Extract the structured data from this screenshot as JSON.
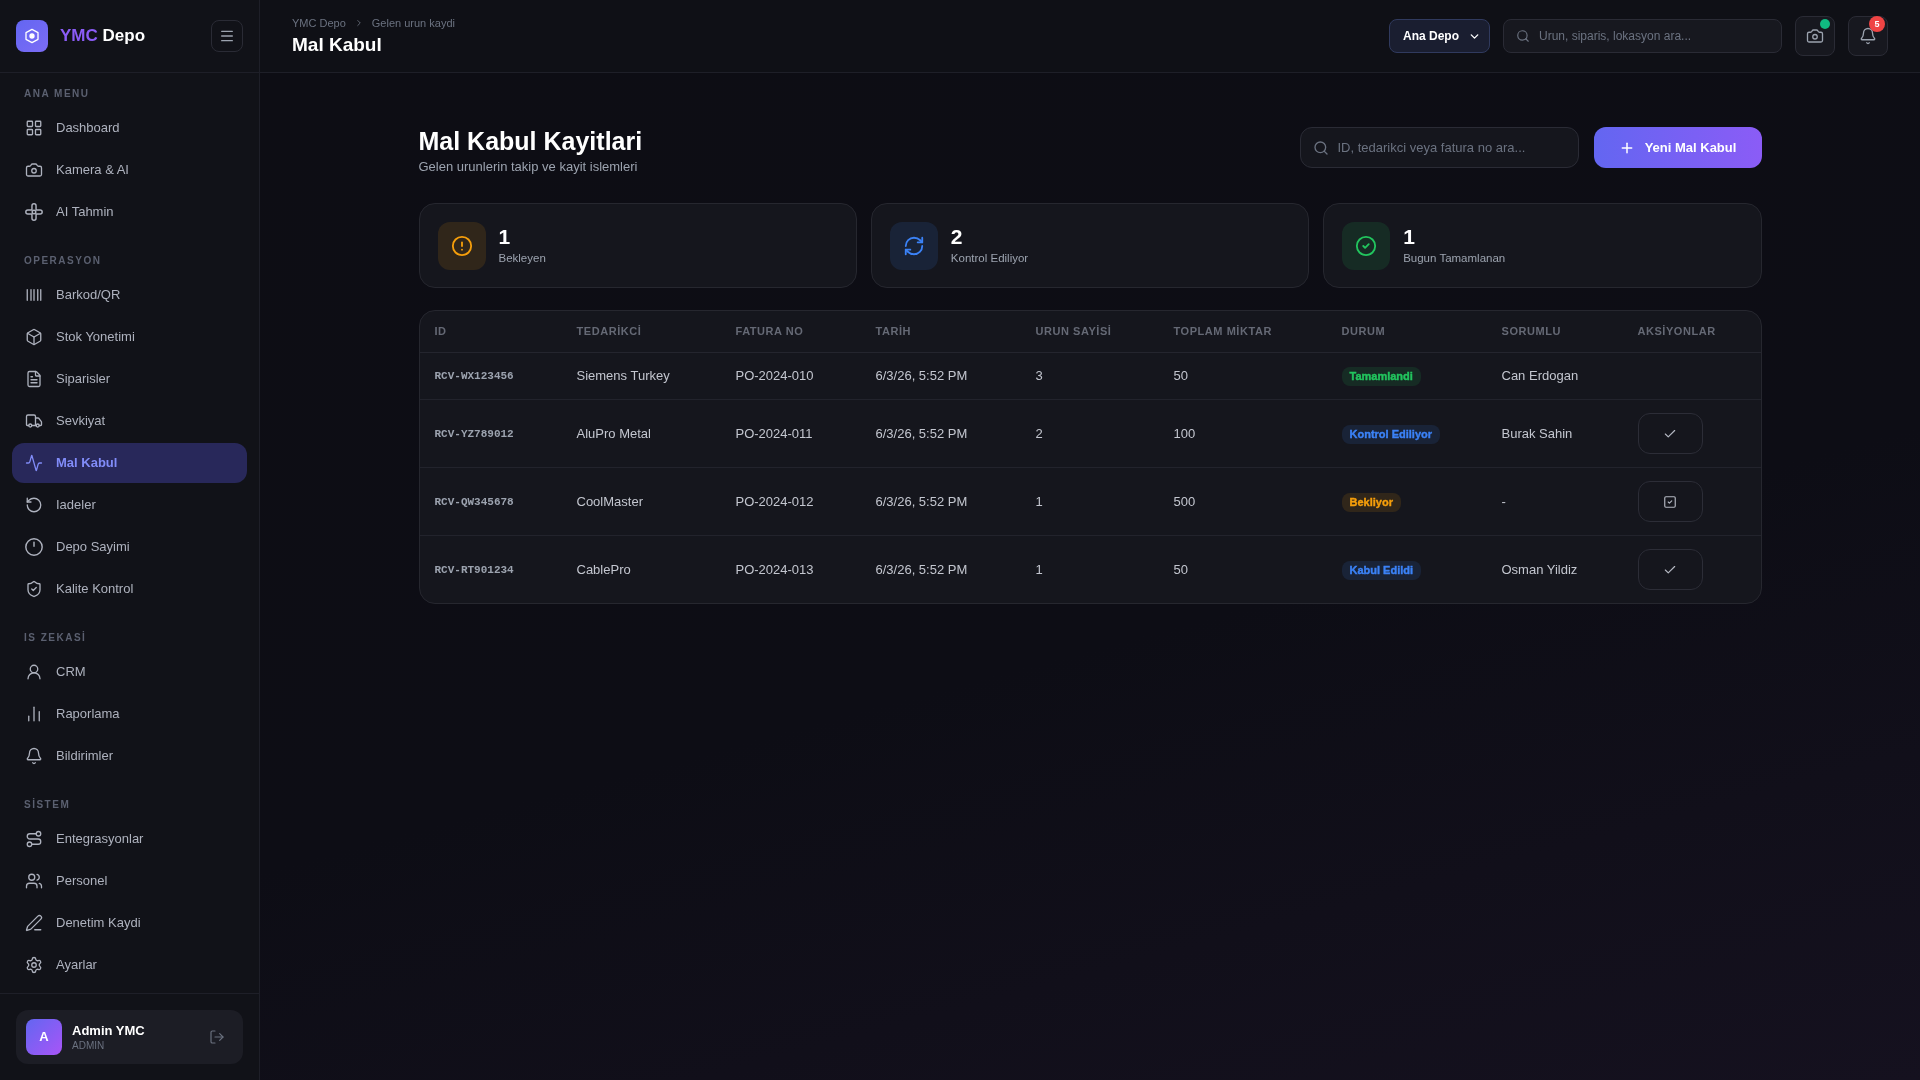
{
  "sidebar": {
    "brand": {
      "accent": "YMC",
      "name": "Depo"
    },
    "sections": [
      {
        "label": "ANA MENU",
        "items": [
          {
            "label": "Dashboard",
            "selected": false
          },
          {
            "label": "Kamera & AI",
            "selected": false
          },
          {
            "label": "AI Tahmin",
            "selected": false
          }
        ]
      },
      {
        "label": "OPERASYON",
        "items": [
          {
            "label": "Barkod/QR",
            "selected": false
          },
          {
            "label": "Stok Yonetimi",
            "selected": false
          },
          {
            "label": "Siparisler",
            "selected": false
          },
          {
            "label": "Sevkiyat",
            "selected": false
          },
          {
            "label": "Mal Kabul",
            "selected": true
          },
          {
            "label": "Iadeler",
            "selected": false
          },
          {
            "label": "Depo Sayimi",
            "selected": false
          },
          {
            "label": "Kalite Kontrol",
            "selected": false
          }
        ]
      },
      {
        "label": "IS ZEKASİ",
        "items": [
          {
            "label": "CRM",
            "selected": false
          },
          {
            "label": "Raporlama",
            "selected": false
          },
          {
            "label": "Bildirimler",
            "selected": false
          }
        ]
      },
      {
        "label": "SİSTEM",
        "items": [
          {
            "label": "Entegrasyonlar",
            "selected": false
          },
          {
            "label": "Personel",
            "selected": false
          },
          {
            "label": "Denetim Kaydi",
            "selected": false
          },
          {
            "label": "Ayarlar",
            "selected": false
          }
        ]
      }
    ],
    "user": {
      "initial": "A",
      "name": "Admin YMC",
      "role": "ADMIN"
    }
  },
  "header": {
    "breadcrumb": [
      "YMC Depo",
      "Gelen urun kaydi"
    ],
    "title": "Mal Kabul",
    "warehouse_select": {
      "value": "Ana Depo"
    },
    "search": {
      "placeholder": "Urun, siparis, lokasyon ara..."
    },
    "camera": {
      "connected": true
    },
    "notifications": {
      "count": "5"
    }
  },
  "page": {
    "title": "Mal Kabul Kayitlari",
    "subtitle": "Gelen urunlerin takip ve kayit islemleri",
    "search": {
      "placeholder": "ID, tedarikci veya fatura no ara..."
    },
    "new_button": "Yeni Mal Kabul"
  },
  "stats": [
    {
      "kind": "pending",
      "value": "1",
      "label": "Bekleyen",
      "color": "#f59e0b"
    },
    {
      "kind": "checking",
      "value": "2",
      "label": "Kontrol Ediliyor",
      "color": "#3b82f6"
    },
    {
      "kind": "done",
      "value": "1",
      "label": "Bugun Tamamlanan",
      "color": "#22c55e"
    }
  ],
  "table": {
    "columns": [
      "ID",
      "TEDARİKCİ",
      "FATURA NO",
      "TARİH",
      "URUN SAYİSİ",
      "TOPLAM MİKTAR",
      "DURUM",
      "SORUMLU",
      "AKSİYONLAR"
    ],
    "rows": [
      {
        "id": "RCV-WX123456",
        "supplier": "Siemens Turkey",
        "invoice": "PO-2024-010",
        "date": "6/3/26, 5:52 PM",
        "item_count": "3",
        "total_quantity": "50",
        "status": {
          "label": "Tamamlandi",
          "color": "#22c55e"
        },
        "responsible": "Can Erdogan"
      },
      {
        "id": "RCV-YZ789012",
        "supplier": "AluPro Metal",
        "invoice": "PO-2024-011",
        "date": "6/3/26, 5:52 PM",
        "item_count": "2",
        "total_quantity": "100",
        "status": {
          "label": "Kontrol Ediliyor",
          "color": "#3b82f6"
        },
        "responsible": "Burak Sahin",
        "action": {
          "kind": "approve"
        }
      },
      {
        "id": "RCV-QW345678",
        "supplier": "CoolMaster",
        "invoice": "PO-2024-012",
        "date": "6/3/26, 5:52 PM",
        "item_count": "1",
        "total_quantity": "500",
        "status": {
          "label": "Bekliyor",
          "color": "#f59e0b"
        },
        "responsible": "-",
        "action": {
          "kind": "inspect"
        }
      },
      {
        "id": "RCV-RT901234",
        "supplier": "CablePro",
        "invoice": "PO-2024-013",
        "date": "6/3/26, 5:52 PM",
        "item_count": "1",
        "total_quantity": "50",
        "status": {
          "label": "Kabul Edildi",
          "color": "#3b82f6"
        },
        "responsible": "Osman Yildiz",
        "action": {
          "kind": "approve"
        }
      }
    ]
  }
}
